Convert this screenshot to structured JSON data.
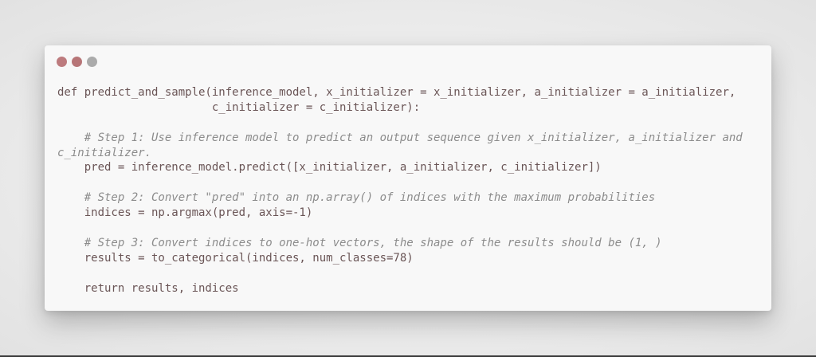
{
  "window": {
    "controls": [
      {
        "name": "close-dot",
        "color": "#bd7b7e"
      },
      {
        "name": "minimize-dot",
        "color": "#b77577"
      },
      {
        "name": "maximize-dot",
        "color": "#ababab"
      }
    ]
  },
  "code": {
    "lines": [
      {
        "text": "def predict_and_sample(inference_model, x_initializer = x_initializer, a_initializer = a_initializer,",
        "kind": "code"
      },
      {
        "text": "                       c_initializer = c_initializer):",
        "kind": "code"
      },
      {
        "text": "",
        "kind": "blank"
      },
      {
        "text": "    # Step 1: Use inference model to predict an output sequence given x_initializer, a_initializer and",
        "kind": "comment"
      },
      {
        "text": "c_initializer.",
        "kind": "comment"
      },
      {
        "text": "    pred = inference_model.predict([x_initializer, a_initializer, c_initializer])",
        "kind": "code"
      },
      {
        "text": "",
        "kind": "blank"
      },
      {
        "text": "    # Step 2: Convert \"pred\" into an np.array() of indices with the maximum probabilities",
        "kind": "comment"
      },
      {
        "text": "    indices = np.argmax(pred, axis=-1)",
        "kind": "code"
      },
      {
        "text": "",
        "kind": "blank"
      },
      {
        "text": "    # Step 3: Convert indices to one-hot vectors, the shape of the results should be (1, )",
        "kind": "comment"
      },
      {
        "text": "    results = to_categorical(indices, num_classes=78)",
        "kind": "code"
      },
      {
        "text": "",
        "kind": "blank"
      },
      {
        "text": "    return results, indices",
        "kind": "code"
      }
    ]
  }
}
